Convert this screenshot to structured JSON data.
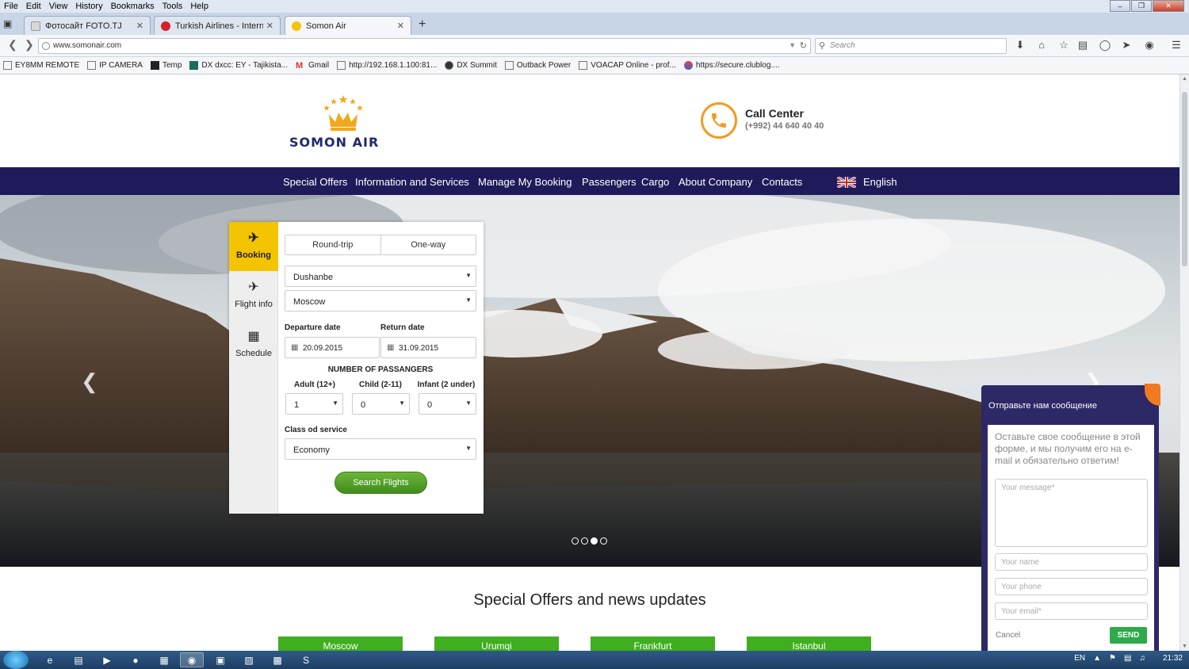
{
  "browser": {
    "menu": [
      "File",
      "Edit",
      "View",
      "History",
      "Bookmarks",
      "Tools",
      "Help"
    ],
    "tabs": [
      {
        "title": "Фотосайт FOTO.TJ",
        "active": false
      },
      {
        "title": "Turkish Airlines - Internatio...",
        "active": false
      },
      {
        "title": "Somon Air",
        "active": true
      }
    ],
    "url": "www.somonair.com",
    "search_placeholder": "Search",
    "bookmarks": [
      "EY8MM REMOTE",
      "IP CAMERA",
      "Temp",
      "DX dxcc: EY - Tajikista...",
      "Gmail",
      "http://192.168.1.100:81...",
      "DX Summit",
      "Outback Power",
      "VOACAP Online - prof...",
      "https://secure.clublog...."
    ]
  },
  "site": {
    "logo_text": "SOMON AIR",
    "call_center": {
      "title": "Call Center",
      "phone": "(+992) 44 640 40 40"
    },
    "nav": [
      "Special Offers",
      "Information and Services",
      "Manage My Booking",
      "Passengers",
      "Cargo",
      "About Company",
      "Contacts"
    ],
    "language": "English",
    "accent_yellow": "#f5c400",
    "nav_color": "#1f1a5a"
  },
  "booking": {
    "side_tabs": [
      {
        "label": "Booking",
        "icon": "airplane-icon",
        "active": true
      },
      {
        "label": "Flight info",
        "icon": "departure-icon",
        "active": false
      },
      {
        "label": "Schedule",
        "icon": "calendar-icon",
        "active": false
      }
    ],
    "trip_types": [
      "Round-trip",
      "One-way"
    ],
    "from": "Dushanbe",
    "to": "Moscow",
    "departure_label": "Departure date",
    "return_label": "Return date",
    "departure": "20.09.2015",
    "return": "31.09.2015",
    "pax_title": "NUMBER OF PASSANGERS",
    "adult_label": "Adult (12+)",
    "child_label": "Child (2-11)",
    "infant_label": "Infant (2 under)",
    "adult": "1",
    "child": "0",
    "infant": "0",
    "class_label": "Class od service",
    "class": "Economy",
    "search_label": "Search Flights"
  },
  "carousel": {
    "slides": 4,
    "active": 3
  },
  "message_widget": {
    "title": "Отправьте нам сообщение",
    "text": "Оставьте свое сообщение в этой форме, и мы получим его на e-mail и обязательно ответим!",
    "message_placeholder": "Your message*",
    "name_placeholder": "Your name",
    "phone_placeholder": "Your phone",
    "email_placeholder": "Your email*",
    "cancel": "Cancel",
    "send": "SEND"
  },
  "offers": {
    "title": "Special Offers and news updates",
    "items": [
      "Moscow",
      "Urumqi",
      "Frankfurt",
      "Istanbul"
    ]
  },
  "taskbar": {
    "lang": "EN",
    "time": "21:32"
  }
}
